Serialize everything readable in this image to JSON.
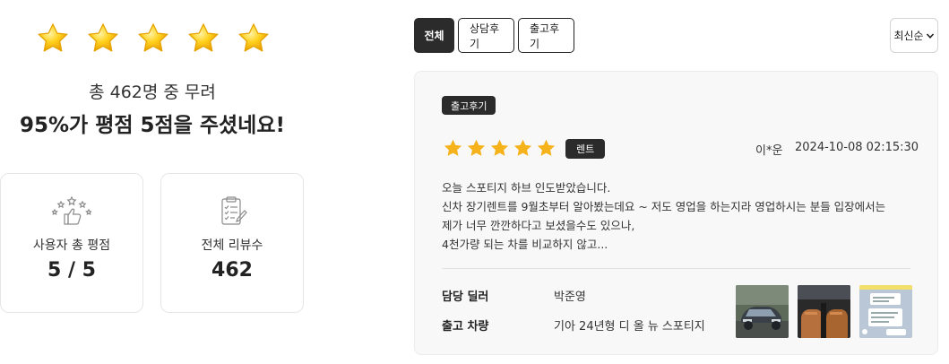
{
  "summary": {
    "line1": "총 462명 중 무려",
    "line2": "95%가 평점 5점을 주셨네요!",
    "star_count": 5
  },
  "stats": {
    "rating_label": "사용자 총 평점",
    "rating_value": "5 / 5",
    "reviews_label": "전체 리뷰수",
    "reviews_value": "462"
  },
  "tabs": [
    {
      "label": "전체",
      "active": true
    },
    {
      "label": "상담후기",
      "active": false
    },
    {
      "label": "출고후기",
      "active": false
    }
  ],
  "sort": {
    "label": "최신순"
  },
  "review": {
    "type_badge": "출고후기",
    "rating": 5,
    "category": "렌트",
    "reviewer": "이*운",
    "date": "2024-10-08 02:15:30",
    "body": [
      "오늘 스포티지 하브 인도받았습니다.",
      "신차 장기렌트를 9월초부터 알아봤는데요 ~ 저도 영업을 하는지라 영업하시는 분들 입장에서는",
      "제가 너무 깐깐하다고 보셨을수도 있으나,",
      "4천가량 되는 차를 비교하지 않고..."
    ],
    "dealer_label": "담당 딜러",
    "dealer_value": "박준영",
    "vehicle_label": "출고 차량",
    "vehicle_value": "기아 24년형 디 올 뉴 스포티지"
  },
  "colors": {
    "star": "#f6b21b",
    "dark": "#2b2b2b",
    "card_bg": "#f8f8f8"
  },
  "icons": {
    "rating_icon": "thumbs-up-stars-icon",
    "reviews_icon": "clipboard-checklist-icon",
    "sort_icon": "chevron-down-icon"
  }
}
